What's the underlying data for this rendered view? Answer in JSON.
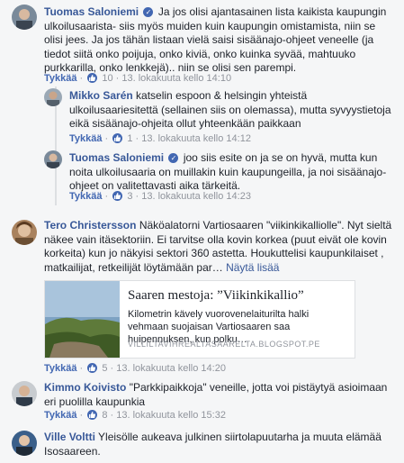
{
  "comments": [
    {
      "name": "Tuomas Saloniemi",
      "text": "Ja jos olisi ajantasainen lista kaikista kaupungin ulkoilusaarista- siis myös muiden kuin kaupungin omistamista, niin se olisi jees. Ja jos tähän listaan vielä saisi sisäänajo-ohjeet veneelle (ja tiedot siitä onko poijuja, onko kiviä, onko kuinka syvää, mahtuuko purkkarilla, onko lenkkejä).. niin se olisi sen parempi.",
      "like": "Tykkää",
      "likes": "10",
      "time": "13. lokakuuta kello 14:10"
    },
    {
      "name": "Mikko Sarén",
      "text": "katselin espoon & helsingin yhteistä ulkoilusaariesitettä (sellainen siis on olemassa), mutta syvyystietoja eikä sisäänajo-ohjeita ollut yhteenkään paikkaan",
      "like": "Tykkää",
      "likes": "1",
      "time": "13. lokakuuta kello 14:12"
    },
    {
      "name": "Tuomas Saloniemi",
      "text": "joo siis esite on ja se on hyvä, mutta kun noita ulkoilusaaria on muillakin kuin kaupungeilla, ja noi sisäänajo-ohjeet on valitettavasti aika tärkeitä.",
      "like": "Tykkää",
      "likes": "3",
      "time": "13. lokakuuta kello 14:23"
    },
    {
      "name": "Tero Christersson",
      "text": "Näköalatorni Vartiosaaren \"viikinkikalliolle\". Nyt sieltä näkee vain itäsektoriin. Ei tarvitse olla kovin korkea (puut eivät ole kovin korkeita) kun jo näkyisi sektori 360 astetta. Houkuttelisi kaupunkilaiset , matkailijat, retkeilijät löytämään par…",
      "more": "Näytä lisää",
      "like": "Tykkää",
      "likes": "5",
      "time": "13. lokakuuta kello 14:20"
    },
    {
      "name": "Kimmo Koivisto",
      "text": "\"Parkkipaikkoja\" veneille, jotta voi pistäytyä asioimaan eri puolilla kaupunkia",
      "like": "Tykkää",
      "likes": "8",
      "time": "13. lokakuuta kello 15:32"
    },
    {
      "name": "Ville Voltti",
      "text": "Yleisölle aukeava julkinen siirtolapuutarha ja muuta elämää Isosaareen."
    }
  ],
  "link_card": {
    "title": "Saaren mestoja: ”Viikinkikallio”",
    "description": "Kilometrin kävely vuorovenelaiturilta halki vehmaan suojaisan Vartiosaaren saa huipennuksen, kun polku…",
    "url": "VILLILTAVIHREALTASAARELTA.BLOGSPOT.PE"
  },
  "colors": {
    "link": "#385898",
    "meta": "#90949c",
    "accent": "#4267b2"
  }
}
